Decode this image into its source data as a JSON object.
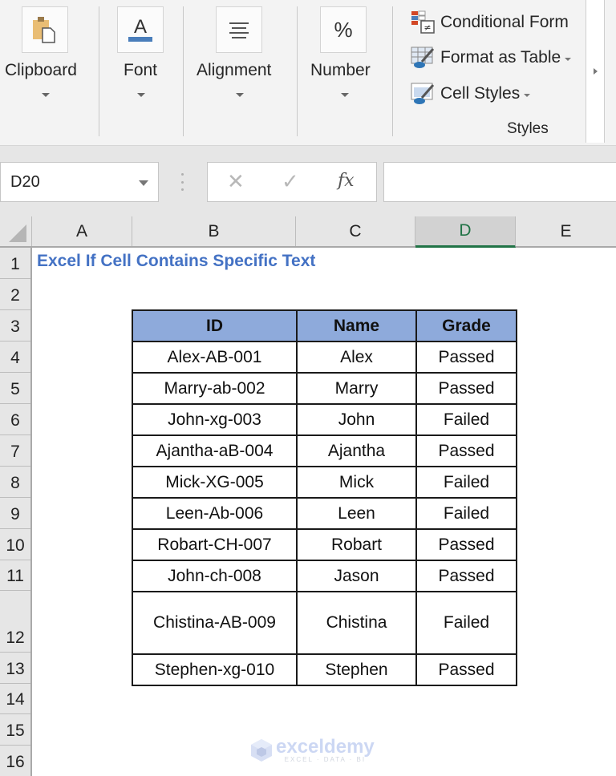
{
  "ribbon": {
    "groups": [
      {
        "label": "Clipboard",
        "icon": "clipboard-paste-icon"
      },
      {
        "label": "Font",
        "icon": "font-color-icon"
      },
      {
        "label": "Alignment",
        "icon": "align-center-icon"
      },
      {
        "label": "Number",
        "icon": "percent-icon",
        "glyph": "%"
      }
    ],
    "styles": {
      "items": [
        {
          "label": "Conditional Form",
          "icon": "conditional-formatting-icon"
        },
        {
          "label": "Format as Table",
          "icon": "format-as-table-icon"
        },
        {
          "label": "Cell Styles",
          "icon": "cell-styles-icon"
        }
      ],
      "group_label": "Styles"
    }
  },
  "formula_bar": {
    "name_box": "D20",
    "cancel_glyph": "✕",
    "enter_glyph": "✓",
    "fx_label": "fx",
    "formula": ""
  },
  "grid": {
    "columns": [
      "A",
      "B",
      "C",
      "D",
      "E"
    ],
    "selected_column": "D",
    "rows": [
      "1",
      "2",
      "3",
      "4",
      "5",
      "6",
      "7",
      "8",
      "9",
      "10",
      "11",
      "12",
      "13",
      "14",
      "15",
      "16"
    ],
    "title": "Excel If Cell Contains Specific Text"
  },
  "table": {
    "headers": [
      "ID",
      "Name",
      "Grade"
    ],
    "rows": [
      [
        "Alex-AB-001",
        "Alex",
        "Passed"
      ],
      [
        "Marry-ab-002",
        "Marry",
        "Passed"
      ],
      [
        "John-xg-003",
        "John",
        "Failed"
      ],
      [
        "Ajantha-aB-004",
        "Ajantha",
        "Passed"
      ],
      [
        "Mick-XG-005",
        "Mick",
        "Failed"
      ],
      [
        "Leen-Ab-006",
        "Leen",
        "Failed"
      ],
      [
        "Robart-CH-007",
        "Robart",
        "Passed"
      ],
      [
        "John-ch-008",
        "Jason",
        "Passed"
      ],
      [
        "Chistina-AB-009",
        "Chistina",
        "Failed"
      ],
      [
        "Stephen-xg-010",
        "Stephen",
        "Passed"
      ]
    ],
    "header_color": "#8eaadb"
  },
  "watermark": {
    "brand": "exceldemy",
    "tagline": "EXCEL · DATA · BI"
  },
  "colors": {
    "accent": "#217346",
    "title": "#4472c4"
  }
}
